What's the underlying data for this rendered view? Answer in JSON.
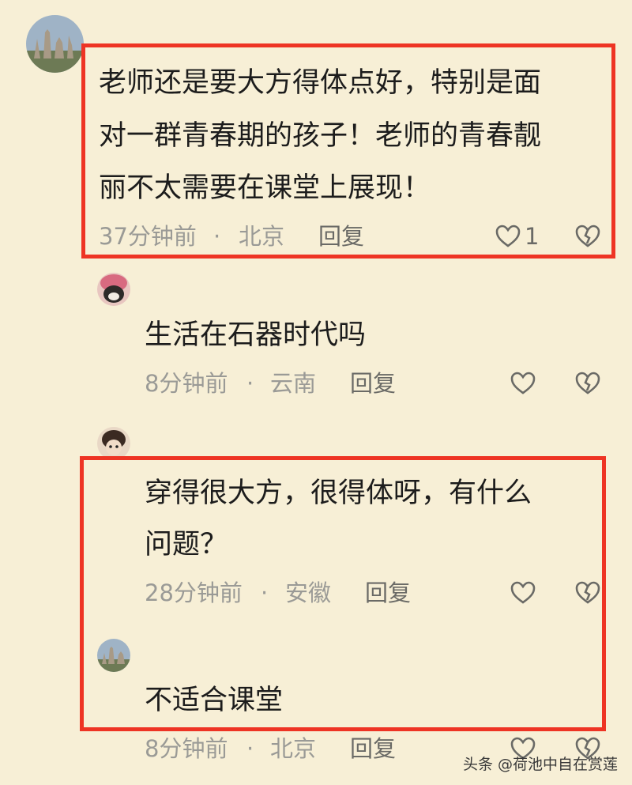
{
  "comments": [
    {
      "lines": [
        "老师还是要大方得体点好，特别是面",
        "对一群青春期的孩子！老师的青春靓",
        "丽不太需要在课堂上展现！"
      ],
      "time": "37分钟前",
      "location": "北京",
      "reply_label": "回复",
      "like_count": "1"
    },
    {
      "lines": [
        "生活在石器时代吗"
      ],
      "time": "8分钟前",
      "location": "云南",
      "reply_label": "回复"
    },
    {
      "lines": [
        "穿得很大方，很得体呀，有什么",
        "问题？"
      ],
      "time": "28分钟前",
      "location": "安徽",
      "reply_label": "回复"
    },
    {
      "lines": [
        "不适合课堂"
      ],
      "time": "8分钟前",
      "location": "北京",
      "reply_label": "回复"
    }
  ],
  "separator": "·",
  "watermark": "头条 @荷池中自在赏莲",
  "colors": {
    "background": "#f7efd6",
    "highlight": "#ee3424",
    "meta": "#9a9a96"
  },
  "icons": [
    "heart-icon",
    "broken-heart-icon"
  ]
}
